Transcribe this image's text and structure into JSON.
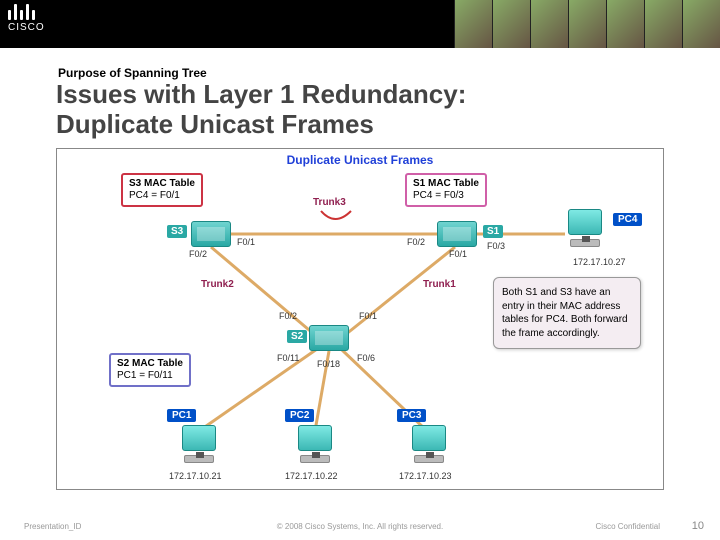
{
  "subtitle": "Purpose of Spanning Tree",
  "title_line1": "Issues with Layer 1 Redundancy:",
  "title_line2": "Duplicate Unicast Frames",
  "diagram_title": "Duplicate Unicast Frames",
  "mac_tables": {
    "s3": {
      "heading": "S3 MAC Table",
      "entry": "PC4 = F0/1"
    },
    "s1": {
      "heading": "S1 MAC Table",
      "entry": "PC4 = F0/3"
    },
    "s2": {
      "heading": "S2 MAC Table",
      "entry": "PC1 = F0/11"
    }
  },
  "switches": {
    "s1": "S1",
    "s2": "S2",
    "s3": "S3"
  },
  "pcs": {
    "pc1": "PC1",
    "pc2": "PC2",
    "pc3": "PC3",
    "pc4": "PC4"
  },
  "ips": {
    "pc1": "172.17.10.21",
    "pc2": "172.17.10.22",
    "pc3": "172.17.10.23",
    "pc4": "172.17.10.27"
  },
  "trunks": {
    "t1": "Trunk1",
    "t2": "Trunk2",
    "t3": "Trunk3"
  },
  "ports": {
    "s3_t3": "F0/1",
    "s1_t3": "F0/2",
    "s1_pc4": "F0/3",
    "s3_t2": "F0/2",
    "s1_t1": "F0/1",
    "s2_t2": "F0/2",
    "s2_t1": "F0/1",
    "s2_pc1": "F0/11",
    "s2_pc3": "F0/6",
    "s2_pc2": "F0/18"
  },
  "callout": "Both S1 and S3 have an entry in their MAC address tables for PC4. Both forward the frame accordingly.",
  "footer": {
    "left": "Presentation_ID",
    "center": "© 2008 Cisco Systems, Inc. All rights reserved.",
    "right": "Cisco Confidential",
    "page": "10"
  }
}
